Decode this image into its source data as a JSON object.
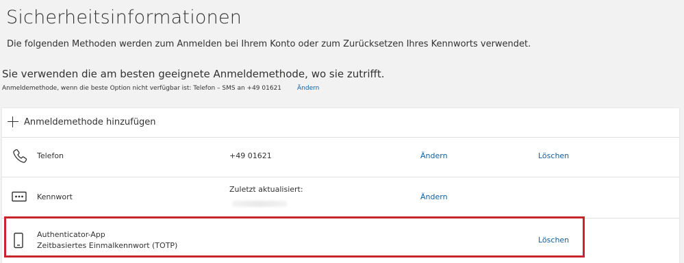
{
  "page": {
    "title": "Sicherheitsinformationen",
    "description": "Die folgenden Methoden werden zum Anmelden bei Ihrem Konto oder zum Zurücksetzen Ihres Kennworts verwendet.",
    "default_heading": "Sie verwenden die am besten geeignete Anmeldemethode, wo sie zutrifft.",
    "default_fallback": "Anmeldemethode, wenn die beste Option nicht verfügbar ist: Telefon – SMS an +49 01621",
    "default_change": "Ändern"
  },
  "add_method": {
    "label": "Anmeldemethode hinzufügen",
    "icon": "plus-icon"
  },
  "methods": [
    {
      "icon": "phone-icon",
      "label": "Telefon",
      "value": "+49 01621",
      "change": "Ändern",
      "delete": "Löschen"
    },
    {
      "icon": "password-icon",
      "label": "Kennwort",
      "value": "Zuletzt aktualisiert:",
      "change": "Ändern"
    },
    {
      "icon": "mobile-device-icon",
      "label": "Authenticator-App",
      "sublabel": "Zeitbasiertes Einmalkennwort (TOTP)",
      "delete": "Löschen"
    }
  ],
  "colors": {
    "link": "#0b5fa5",
    "highlight": "#c8242b",
    "background": "#f2f2f2"
  }
}
